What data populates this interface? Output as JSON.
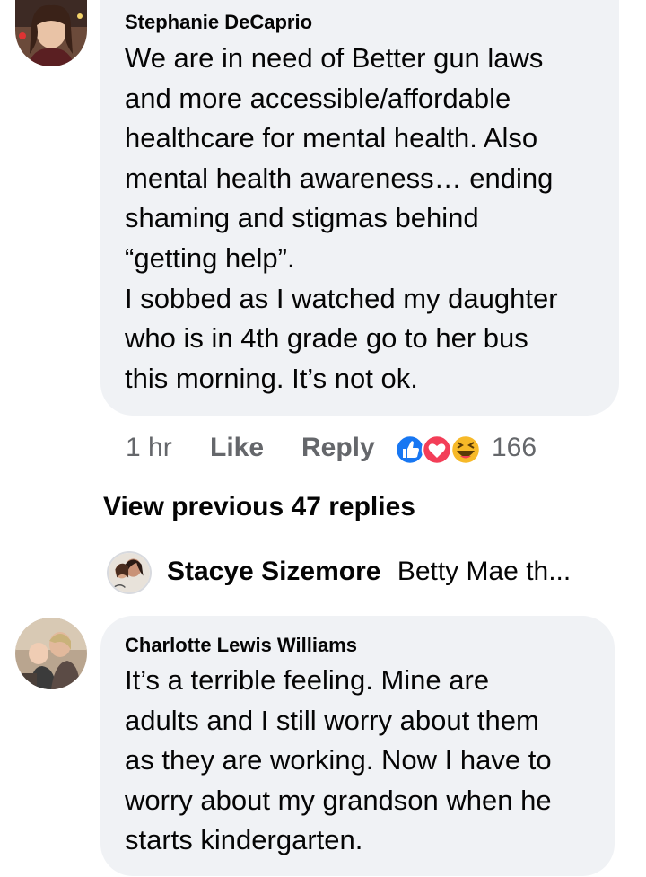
{
  "comments": [
    {
      "author": "Stephanie DeCaprio",
      "text": "We are in need of Better gun laws\nand more accessible/affordable\nhealthcare for mental health. Also\nmental health awareness… ending\nshaming and stigmas behind\n“getting help”.\nI sobbed as I watched my daughter\nwho is in 4th grade go to her bus\nthis morning. It’s not ok.",
      "time": "1 hr",
      "like_label": "Like",
      "reply_label": "Reply",
      "reaction_icons": [
        "like-icon",
        "love-icon",
        "haha-icon"
      ],
      "reaction_count": "166"
    },
    {
      "author": "Charlotte Lewis Williams",
      "text": "It’s a terrible feeling. Mine are\nadults and I still worry about them\nas they are working. Now I have to\nworry about my grandson when he\nstarts kindergarten."
    }
  ],
  "view_previous": "View previous 47 replies",
  "reply_preview": {
    "author": "Stacye Sizemore",
    "snippet": "Betty Mae th..."
  },
  "colors": {
    "bubble": "#f0f2f5",
    "meta_text": "#65676b",
    "like_blue": "#1877f2",
    "love_red": "#f33e58",
    "haha_yellow": "#f7b928"
  }
}
